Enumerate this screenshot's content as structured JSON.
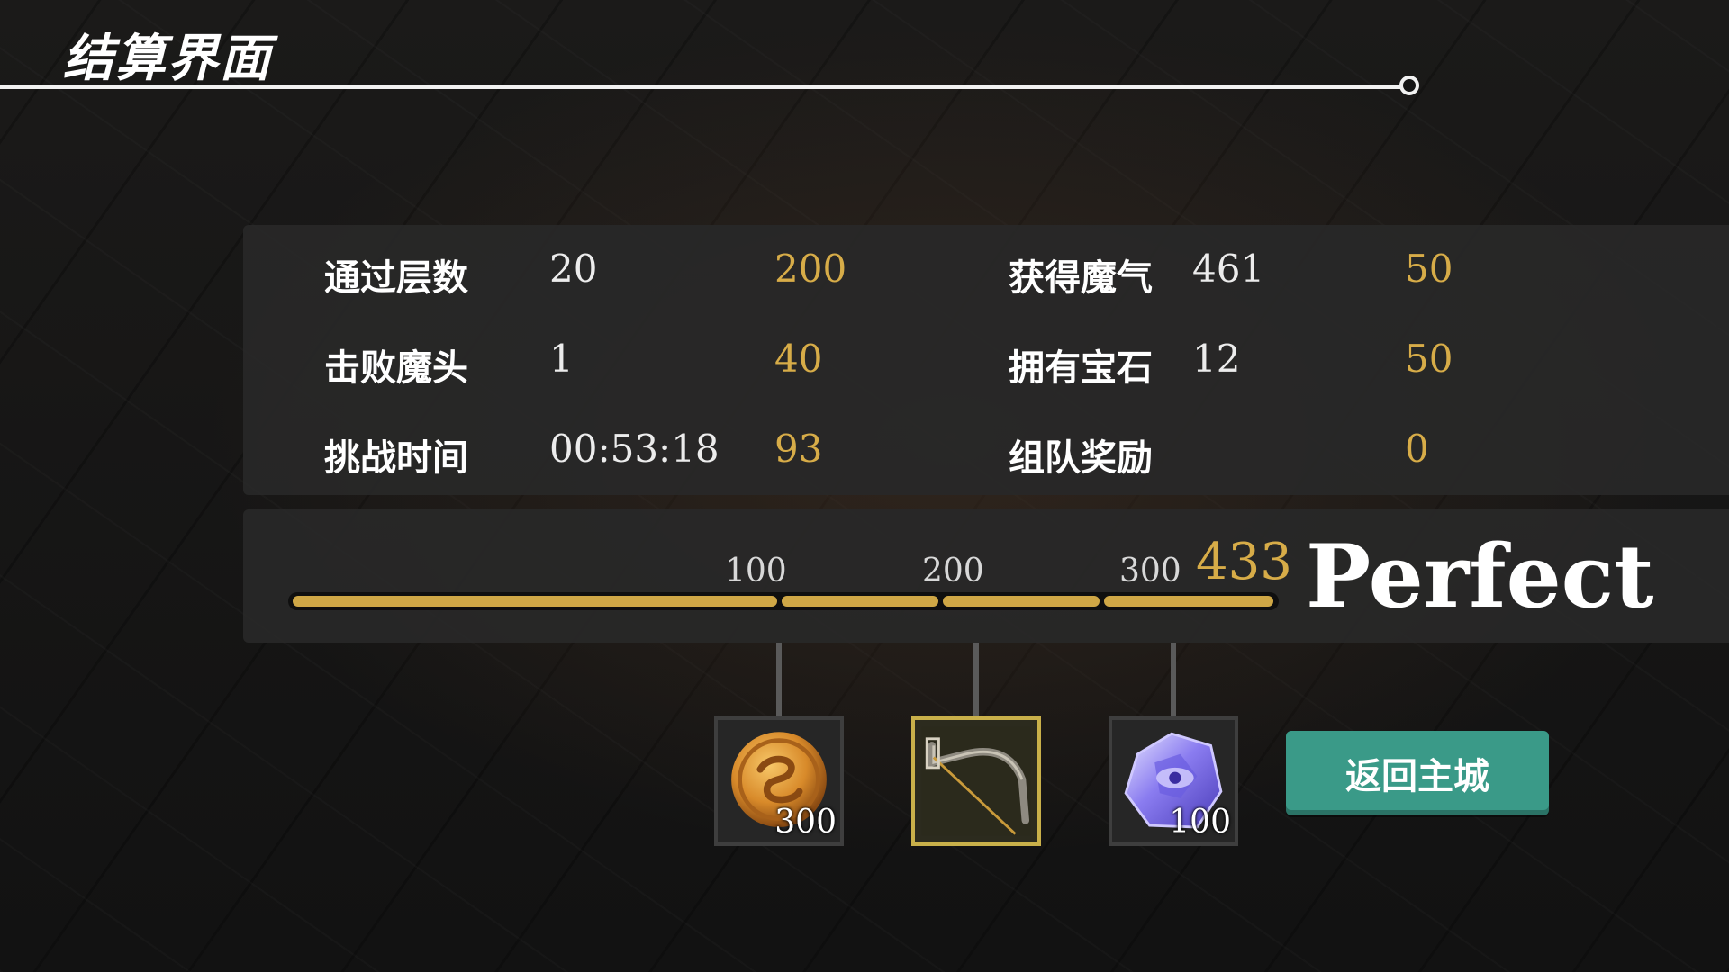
{
  "header": {
    "title": "结算界面"
  },
  "stats": {
    "left": [
      {
        "label": "通过层数",
        "value": "20",
        "score": "200"
      },
      {
        "label": "击败魔头",
        "value": "1",
        "score": "40"
      },
      {
        "label": "挑战时间",
        "value": "00:53:18",
        "score": "93"
      }
    ],
    "right": [
      {
        "label": "获得魔气",
        "value": "461",
        "score": "50"
      },
      {
        "label": "拥有宝石",
        "value": "12",
        "score": "50"
      },
      {
        "label": "组队奖励",
        "value": "",
        "score": "0"
      }
    ]
  },
  "score_bar": {
    "ticks": [
      "100",
      "200",
      "300"
    ],
    "total": "433",
    "progress": 1.0,
    "grade": "Perfect",
    "colors": {
      "fill": "#cfa746",
      "track": "#0f0f0f"
    }
  },
  "rewards": [
    {
      "icon": "gold-coin-icon",
      "count": "300",
      "selected": false
    },
    {
      "icon": "bow-icon",
      "count": "",
      "selected": true
    },
    {
      "icon": "crystal-gem-icon",
      "count": "100",
      "selected": false
    }
  ],
  "actions": {
    "return_label": "返回主城",
    "color": "#3a9a88"
  },
  "colors": {
    "score": "#d7ac48",
    "accent": "#3a9a88"
  }
}
